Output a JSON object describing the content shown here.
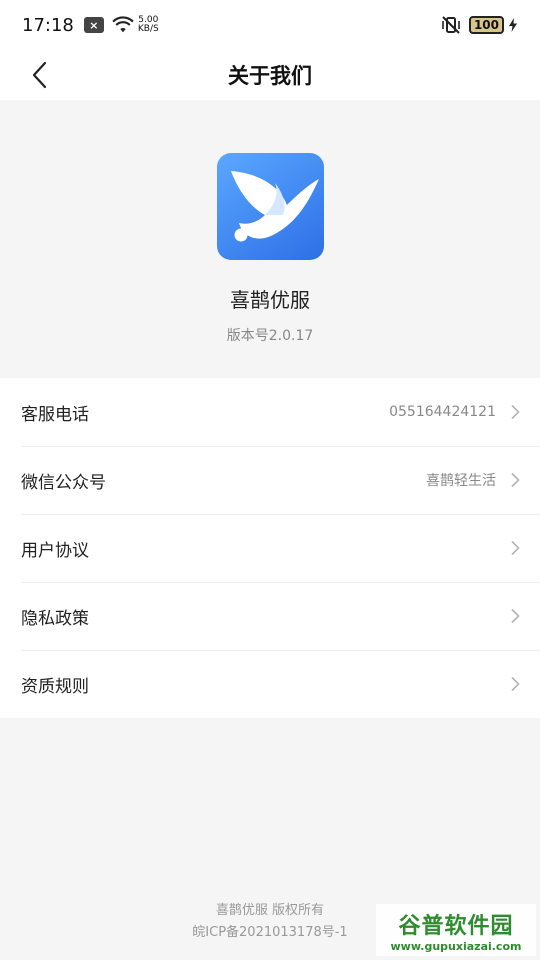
{
  "status_bar": {
    "time": "17:18",
    "notif_badge": "×",
    "speed_value": "5.00",
    "speed_unit": "KB/S",
    "battery": "100"
  },
  "title_bar": {
    "title": "关于我们"
  },
  "app_info": {
    "name": "喜鹊优服",
    "version": "版本号2.0.17"
  },
  "menu": {
    "items": [
      {
        "label": "客服电话",
        "value": "055164424121"
      },
      {
        "label": "微信公众号",
        "value": "喜鹊轻生活"
      },
      {
        "label": "用户协议",
        "value": ""
      },
      {
        "label": "隐私政策",
        "value": ""
      },
      {
        "label": "资质规则",
        "value": ""
      }
    ]
  },
  "footer": {
    "copyright": "喜鹊优服 版权所有",
    "icp": "皖ICP备2021013178号-1"
  },
  "watermark": {
    "title": "谷普软件园",
    "url": "www.gupuxiazai.com"
  },
  "colors": {
    "accent": "#2d6fe6",
    "background": "#f5f5f5"
  }
}
